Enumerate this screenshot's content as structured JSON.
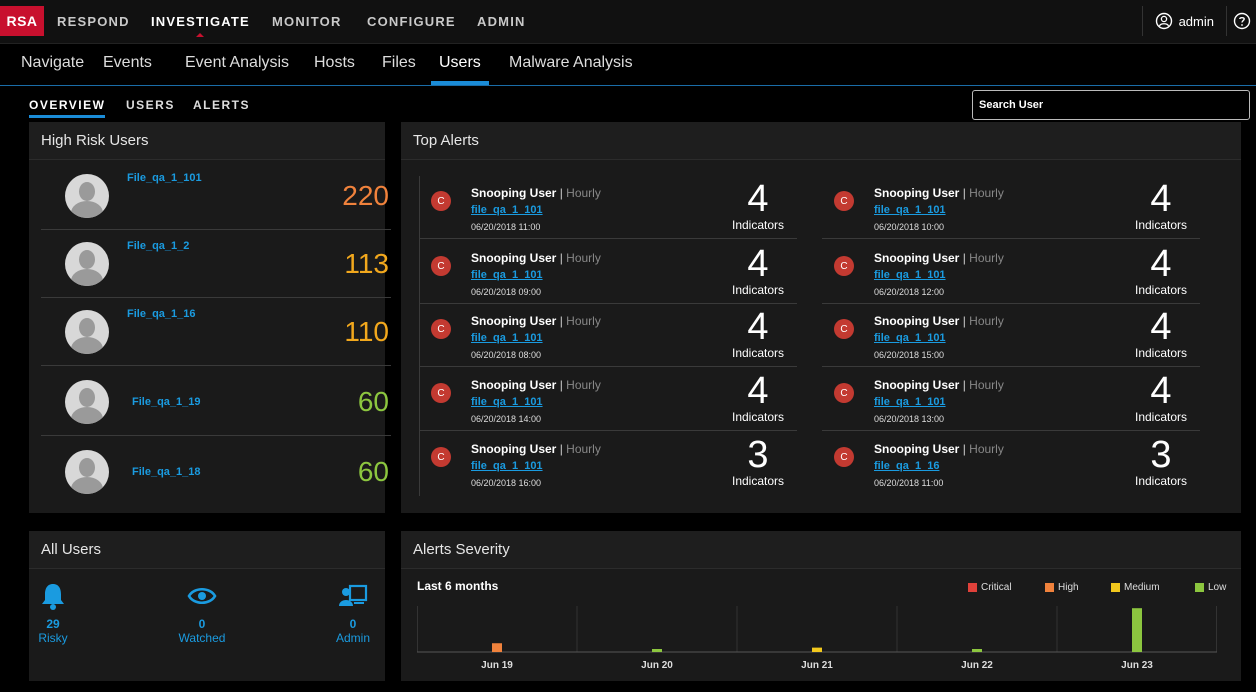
{
  "brand": "RSA",
  "topnav": {
    "items": [
      {
        "label": "RESPOND"
      },
      {
        "label": "INVESTIGATE"
      },
      {
        "label": "MONITOR"
      },
      {
        "label": "CONFIGURE"
      },
      {
        "label": "ADMIN"
      }
    ],
    "active": "INVESTIGATE",
    "user_label": "admin"
  },
  "subnav": {
    "items": [
      {
        "label": "Navigate"
      },
      {
        "label": "Events"
      },
      {
        "label": "Event Analysis"
      },
      {
        "label": "Hosts"
      },
      {
        "label": "Files"
      },
      {
        "label": "Users"
      },
      {
        "label": "Malware Analysis"
      }
    ],
    "active": "Users"
  },
  "tabs": {
    "items": [
      {
        "label": "OVERVIEW"
      },
      {
        "label": "USERS"
      },
      {
        "label": "ALERTS"
      }
    ],
    "active": "OVERVIEW"
  },
  "search": {
    "placeholder": "Search User"
  },
  "high_risk": {
    "title": "High Risk Users",
    "users": [
      {
        "name": "File_qa_1_101",
        "score": "220",
        "color": "#f0823c"
      },
      {
        "name": "File_qa_1_2",
        "score": "113",
        "color": "#f2a81d"
      },
      {
        "name": "File_qa_1_16",
        "score": "110",
        "color": "#f2a81d"
      },
      {
        "name": "File_qa_1_19",
        "score": "60",
        "color": "#8cc63f"
      },
      {
        "name": "File_qa_1_18",
        "score": "60",
        "color": "#8cc63f"
      }
    ]
  },
  "top_alerts": {
    "title": "Top Alerts",
    "severity_letter": "C",
    "indicators_label": "Indicators",
    "left": [
      {
        "name": "Snooping User",
        "sep": "|",
        "freq": "Hourly",
        "user": "file_qa_1_101",
        "date": "06/20/2018 11:00",
        "count": "4"
      },
      {
        "name": "Snooping User",
        "sep": "|",
        "freq": "Hourly",
        "user": "file_qa_1_101",
        "date": "06/20/2018 09:00",
        "count": "4"
      },
      {
        "name": "Snooping User",
        "sep": "|",
        "freq": "Hourly",
        "user": "file_qa_1_101",
        "date": "06/20/2018 08:00",
        "count": "4"
      },
      {
        "name": "Snooping User",
        "sep": "|",
        "freq": "Hourly",
        "user": "file_qa_1_101",
        "date": "06/20/2018 14:00",
        "count": "4"
      },
      {
        "name": "Snooping User",
        "sep": "|",
        "freq": "Hourly",
        "user": "file_qa_1_101",
        "date": "06/20/2018 16:00",
        "count": "3"
      }
    ],
    "right": [
      {
        "name": "Snooping User",
        "sep": "|",
        "freq": "Hourly",
        "user": "file_qa_1_101",
        "date": "06/20/2018 10:00",
        "count": "4"
      },
      {
        "name": "Snooping User",
        "sep": "|",
        "freq": "Hourly",
        "user": "file_qa_1_101",
        "date": "06/20/2018 12:00",
        "count": "4"
      },
      {
        "name": "Snooping User",
        "sep": "|",
        "freq": "Hourly",
        "user": "file_qa_1_101",
        "date": "06/20/2018 15:00",
        "count": "4"
      },
      {
        "name": "Snooping User",
        "sep": "|",
        "freq": "Hourly",
        "user": "file_qa_1_101",
        "date": "06/20/2018 13:00",
        "count": "4"
      },
      {
        "name": "Snooping User",
        "sep": "|",
        "freq": "Hourly",
        "user": "file_qa_1_16",
        "date": "06/20/2018 11:00",
        "count": "3"
      }
    ]
  },
  "all_users": {
    "title": "All Users",
    "items": [
      {
        "icon": "bell-icon",
        "count": "29",
        "label": "Risky"
      },
      {
        "icon": "eye-icon",
        "count": "0",
        "label": "Watched"
      },
      {
        "icon": "admin-user-icon",
        "count": "0",
        "label": "Admin"
      }
    ]
  },
  "alerts_severity": {
    "title": "Alerts Severity",
    "range_label": "Last 6 months",
    "legend": [
      {
        "label": "Critical",
        "color": "#e0413a"
      },
      {
        "label": "High",
        "color": "#f0823c"
      },
      {
        "label": "Medium",
        "color": "#f2c81d"
      },
      {
        "label": "Low",
        "color": "#8cc63f"
      }
    ]
  },
  "chart_data": {
    "type": "bar",
    "categories": [
      "Jun 19",
      "Jun 20",
      "Jun 21",
      "Jun 22",
      "Jun 23"
    ],
    "series": [
      {
        "name": "Critical",
        "values": [
          0,
          0,
          0,
          0,
          0
        ]
      },
      {
        "name": "High",
        "values": [
          2,
          0,
          0,
          0,
          0
        ]
      },
      {
        "name": "Medium",
        "values": [
          0,
          0,
          1,
          0,
          0
        ]
      },
      {
        "name": "Low",
        "values": [
          0,
          0.4,
          0,
          0.6,
          10
        ]
      }
    ],
    "stacked": true,
    "legend_position": "top-right",
    "grid": true
  }
}
